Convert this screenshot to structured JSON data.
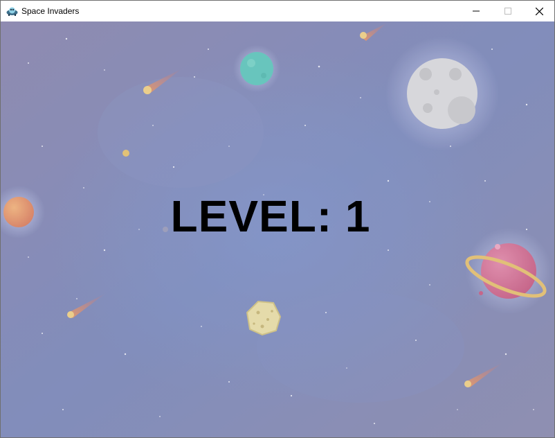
{
  "window": {
    "title": "Space Invaders",
    "app_icon": "space-invader-icon",
    "controls": [
      "minimize-icon",
      "maximize-icon",
      "close-icon"
    ]
  },
  "game": {
    "level_text": "LEVEL: 1",
    "background": "space-scene",
    "colors": {
      "sky": "#7d86b2",
      "moon": "#dcdcdc",
      "teal_planet": "#5ec8ba",
      "orange_planet": "#e58c5c",
      "pink_planet": "#d96a8c",
      "ring": "#e7c26b",
      "asteroid": "#ece1a4",
      "text": "#000000"
    }
  }
}
